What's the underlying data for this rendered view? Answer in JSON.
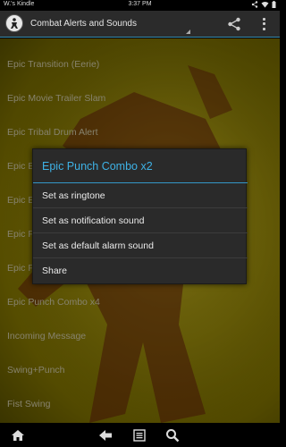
{
  "status_bar": {
    "device_name": "W.'s Kindle",
    "time": "3:37 PM",
    "icons": [
      "share-network-icon",
      "wifi-icon",
      "battery-icon"
    ]
  },
  "action_bar": {
    "title": "Combat Alerts and Sounds",
    "icons": [
      "app-logo-icon",
      "share-icon",
      "overflow-menu-icon"
    ]
  },
  "list": {
    "items": [
      "Epic Transition (Eerie)",
      "Epic Movie Trailer Slam",
      "Epic Tribal Drum Alert",
      "Epic E",
      "Epic E",
      "Epic P",
      "Epic P",
      "Epic Punch Combo x4",
      "Incoming Message",
      "Swing+Punch",
      "Fist Swing"
    ]
  },
  "dialog": {
    "title": "Epic Punch Combo x2",
    "options": [
      "Set as ringtone",
      "Set as notification sound",
      "Set as default alarm sound",
      "Share"
    ]
  },
  "nav_bar": {
    "icons": [
      "home-icon",
      "back-icon",
      "menu-icon",
      "search-icon"
    ]
  },
  "colors": {
    "accent": "#3eb2e6",
    "background_yellow": "#c9b712",
    "dialog_bg": "#2a2a2a"
  }
}
